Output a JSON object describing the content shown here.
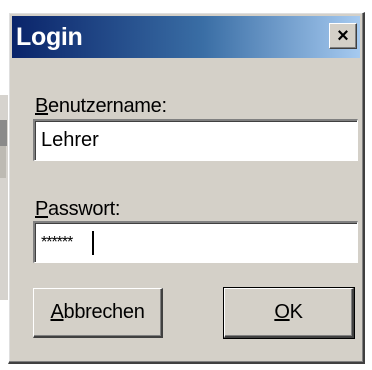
{
  "dialog": {
    "title": "Login",
    "close_glyph": "×"
  },
  "username": {
    "label_accel": "B",
    "label_rest": "enutzername:",
    "value": "Lehrer"
  },
  "password": {
    "label_accel": "P",
    "label_rest": "asswort:",
    "masked_value": "******"
  },
  "buttons": {
    "cancel_accel": "A",
    "cancel_rest": "bbrechen",
    "ok_accel": "O",
    "ok_rest": "K"
  }
}
